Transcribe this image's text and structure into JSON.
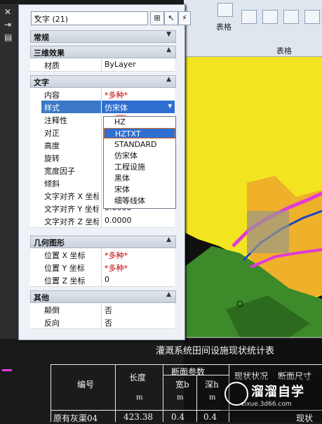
{
  "palette": {
    "object_selector": "文字 (21)",
    "sections": [
      {
        "title": "常规",
        "collapsed": true
      },
      {
        "title": "三维效果",
        "rows": [
          {
            "key": "材质",
            "value": "ByLayer"
          }
        ]
      },
      {
        "title": "文字",
        "rows": [
          {
            "key": "内容",
            "value": "*多种*",
            "red": true
          },
          {
            "key": "样式",
            "value": "仿宋体",
            "highlight": true
          },
          {
            "key": "注释性",
            "value": ""
          },
          {
            "key": "对正",
            "value": ""
          },
          {
            "key": "高度",
            "value": ""
          },
          {
            "key": "旋转",
            "value": ""
          },
          {
            "key": "宽度因子",
            "value": ""
          },
          {
            "key": "倾斜",
            "value": ""
          },
          {
            "key": "文字对齐 X 坐标",
            "value": ""
          },
          {
            "key": "文字对齐 Y 坐标",
            "value": "0.0000"
          },
          {
            "key": "文字对齐 Z 坐标",
            "value": "0.0000"
          }
        ]
      },
      {
        "title": "几何图形",
        "rows": [
          {
            "key": "位置 X 坐标",
            "value": "*多种*",
            "red": true
          },
          {
            "key": "位置 Y 坐标",
            "value": "*多种*",
            "red": true
          },
          {
            "key": "位置 Z 坐标",
            "value": "0"
          }
        ]
      },
      {
        "title": "其他",
        "rows": [
          {
            "key": "颠倒",
            "value": "否"
          },
          {
            "key": "反向",
            "value": "否"
          }
        ]
      }
    ],
    "style_dropdown": [
      "HZ",
      "HZTXT",
      "STANDARD",
      "仿宋体",
      "工程设施",
      "黑体",
      "宋体",
      "细等线体"
    ],
    "style_selected": "HZTXT"
  },
  "ribbon": {
    "table_label": "表格",
    "group_label": "表格"
  },
  "table": {
    "title": "灌溉系统田间设施现状统计表",
    "headers": [
      "编号",
      "长度",
      "断面参数",
      "宽b",
      "深h",
      "现状状况",
      "断面尺寸"
    ],
    "units": [
      "m",
      "m",
      "m"
    ],
    "row": [
      "原有灰渠04",
      "423.38",
      "0.4",
      "0.4",
      "现状"
    ]
  },
  "watermark": {
    "name": "溜溜自学",
    "url": "zixue.3d66.com"
  },
  "colors": {
    "accent": "#2f6fd0",
    "yellow_area": "#f2e51f",
    "green_area": "#3d8a2a",
    "magenta_line": "#e23ad8"
  }
}
